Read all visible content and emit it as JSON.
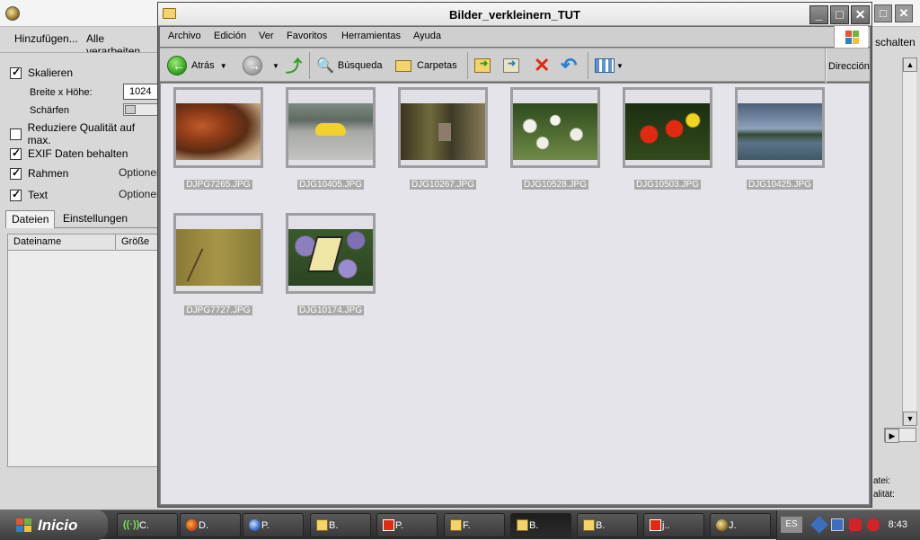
{
  "background_app": {
    "toolbar": {
      "add_label": "Hinzufügen...",
      "process_all_label": "Alle verarbeiten..."
    },
    "options": {
      "scale": {
        "label": "Skalieren",
        "checked": true
      },
      "size_label": "Breite x Höhe:",
      "size_value": "1024",
      "sharpen_label": "Schärfen",
      "reduce_quality": {
        "label": "Reduziere Qualität auf max.",
        "checked": false
      },
      "keep_exif": {
        "label": "EXIF Daten behalten",
        "checked": true
      },
      "frame": {
        "label": "Rahmen",
        "checked": true,
        "options_label": "Optionen"
      },
      "text": {
        "label": "Text",
        "checked": true,
        "options_label": "Optionen"
      }
    },
    "tabs": [
      "Dateien",
      "Einstellungen"
    ],
    "columns": [
      "Dateiname",
      "Größe"
    ],
    "right_button_text": "schalten",
    "right_labels": [
      "atei:",
      "alität:"
    ]
  },
  "explorer": {
    "title": "Bilder_verkleinern_TUT",
    "menu": [
      "Archivo",
      "Edición",
      "Ver",
      "Favoritos",
      "Herramientas",
      "Ayuda"
    ],
    "toolbar": {
      "back_label": "Atrás",
      "search_label": "Búsqueda",
      "folders_label": "Carpetas",
      "address_label": "Dirección"
    },
    "files": [
      {
        "name": "DJPG7265.JPG"
      },
      {
        "name": "DJG10405.JPG"
      },
      {
        "name": "DJG10267.JPG"
      },
      {
        "name": "DJG10528.JPG"
      },
      {
        "name": "DJG10503.JPG"
      },
      {
        "name": "DJG10425.JPG"
      },
      {
        "name": "DJPG7727.JPG"
      },
      {
        "name": "DJG10174.JPG"
      }
    ]
  },
  "taskbar": {
    "start_label": "Inicio",
    "buttons": [
      {
        "label": "C.",
        "icon": "network-icon"
      },
      {
        "label": "D.",
        "icon": "firefox-icon"
      },
      {
        "label": "P.",
        "icon": "thunderbird-icon"
      },
      {
        "label": "B.",
        "icon": "folder-icon"
      },
      {
        "label": "P.",
        "icon": "paint-icon"
      },
      {
        "label": "F.",
        "icon": "folder-icon"
      },
      {
        "label": "B.",
        "icon": "folder-icon",
        "active": true
      },
      {
        "label": "B.",
        "icon": "folder-icon"
      },
      {
        "label": "j..",
        "icon": "paint-icon"
      },
      {
        "label": "J.",
        "icon": "app-icon"
      }
    ],
    "language": "ES",
    "clock": "8:43"
  }
}
